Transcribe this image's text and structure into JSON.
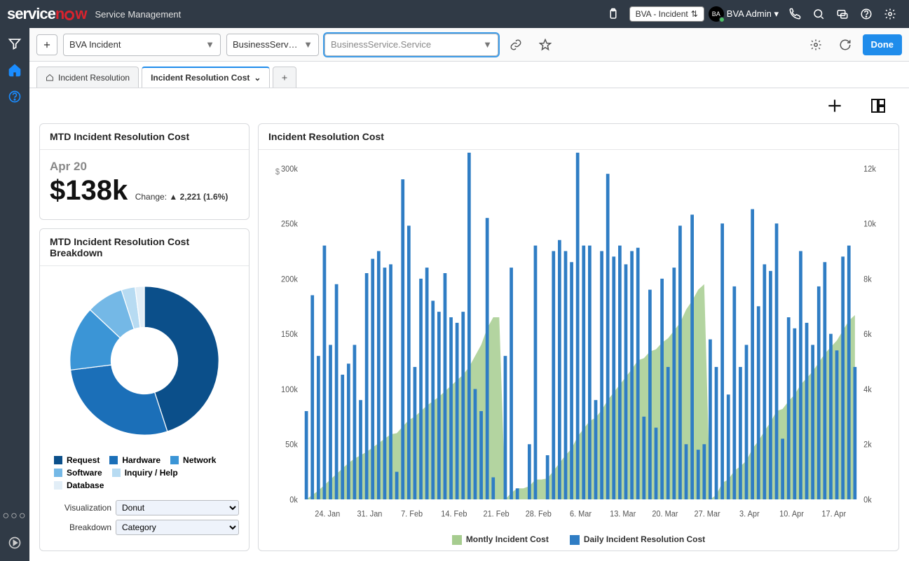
{
  "header": {
    "subtitle": "Service Management",
    "bva_selector": "BVA - Incident",
    "user_initials": "BA",
    "user_name": "BVA Admin"
  },
  "toolbar": {
    "dd1": "BVA Incident",
    "dd2": "BusinessService.Se...",
    "dd3_placeholder": "BusinessService.Service",
    "done": "Done"
  },
  "tabs": {
    "tab1": "Incident Resolution",
    "tab2": "Incident Resolution Cost"
  },
  "kpi": {
    "title": "MTD Incident Resolution Cost",
    "date": "Apr 20",
    "value": "$138k",
    "change_label": "Change:",
    "change_arrow": "▲",
    "change_value": "2,221 (1.6%)"
  },
  "breakdown": {
    "title": "MTD Incident Resolution Cost Breakdown",
    "viz_label": "Visualization",
    "viz_value": "Donut",
    "brk_label": "Breakdown",
    "brk_value": "Category",
    "pie_colors": [
      "#0b4f8a",
      "#1b6fb8",
      "#3b95d6",
      "#74b8e6",
      "#b7dbf2",
      "#e2eef7"
    ],
    "legend": [
      {
        "label": "Request",
        "color": "#0b4f8a"
      },
      {
        "label": "Hardware",
        "color": "#1b6fb8"
      },
      {
        "label": "Network",
        "color": "#3b95d6"
      },
      {
        "label": "Software",
        "color": "#74b8e6"
      },
      {
        "label": "Inquiry / Help",
        "color": "#b7dbf2"
      },
      {
        "label": "Database",
        "color": "#e2eef7"
      }
    ]
  },
  "chart": {
    "title": "Incident Resolution Cost",
    "y_currency": "$",
    "legend_area": "Montly Incident Cost",
    "legend_bar": "Daily Incident Resolution Cost",
    "colors": {
      "area": "#a6cc8f",
      "bar": "#2f7dc4"
    }
  },
  "chart_data": {
    "type": "bar",
    "ylabel": "$",
    "ylim_left": [
      0,
      300000
    ],
    "y_ticks_left": [
      "0k",
      "50k",
      "100k",
      "150k",
      "200k",
      "250k",
      "300k"
    ],
    "ylim_right": [
      0,
      12000
    ],
    "y_ticks_right": [
      "0k",
      "2k",
      "4k",
      "6k",
      "8k",
      "10k",
      "12k"
    ],
    "x_ticks": [
      "24. Jan",
      "31. Jan",
      "7. Feb",
      "14. Feb",
      "21. Feb",
      "28. Feb",
      "6. Mar",
      "13. Mar",
      "20. Mar",
      "27. Mar",
      "3. Apr",
      "10. Apr",
      "17. Apr"
    ],
    "categories_start": "2018-01-20",
    "pie_slices": [
      {
        "name": "Request",
        "value": 45
      },
      {
        "name": "Hardware",
        "value": 28
      },
      {
        "name": "Network",
        "value": 14
      },
      {
        "name": "Software",
        "value": 8
      },
      {
        "name": "Inquiry / Help",
        "value": 3
      },
      {
        "name": "Database",
        "value": 2
      }
    ],
    "series": [
      {
        "name": "Daily Incident Resolution Cost",
        "axis": "left",
        "type": "bar",
        "values": [
          80,
          185,
          130,
          230,
          140,
          195,
          113,
          123,
          140,
          90,
          205,
          218,
          225,
          210,
          213,
          25,
          290,
          248,
          120,
          200,
          210,
          180,
          170,
          205,
          165,
          160,
          170,
          325,
          100,
          80,
          255,
          20,
          0,
          130,
          210,
          10,
          0,
          50,
          230,
          0,
          40,
          225,
          235,
          225,
          215,
          340,
          230,
          230,
          90,
          225,
          295,
          220,
          230,
          213,
          225,
          228,
          75,
          190,
          65,
          200,
          120,
          210,
          248,
          50,
          258,
          45,
          50,
          145,
          120,
          250,
          95,
          193,
          120,
          140,
          263,
          175,
          213,
          207,
          250,
          55,
          165,
          155,
          225,
          160,
          140,
          193,
          215,
          150,
          135,
          220,
          230,
          120
        ]
      },
      {
        "name": "Montly Incident Cost",
        "axis": "left",
        "type": "area",
        "values": [
          0,
          4,
          8,
          13,
          18,
          23,
          28,
          33,
          37,
          40,
          43,
          47,
          51,
          55,
          59,
          60,
          66,
          72,
          75,
          80,
          85,
          89,
          93,
          98,
          103,
          108,
          113,
          120,
          130,
          140,
          155,
          165,
          165,
          0,
          6,
          10,
          10,
          12,
          18,
          18,
          19,
          26,
          33,
          40,
          46,
          57,
          64,
          71,
          74,
          81,
          90,
          97,
          104,
          111,
          118,
          126,
          128,
          134,
          136,
          142,
          146,
          153,
          160,
          172,
          180,
          190,
          195,
          0,
          4,
          15,
          18,
          26,
          30,
          35,
          46,
          53,
          62,
          70,
          80,
          82,
          89,
          95,
          104,
          110,
          116,
          124,
          132,
          138,
          144,
          153,
          162,
          167
        ]
      }
    ]
  }
}
